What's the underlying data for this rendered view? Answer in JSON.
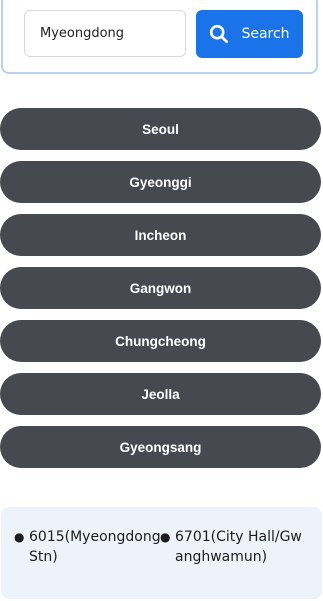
{
  "search": {
    "input_value": "Myeongdong",
    "button_label": "Search",
    "icon": "search-icon"
  },
  "regions": [
    {
      "label": "Seoul"
    },
    {
      "label": "Gyeonggi"
    },
    {
      "label": "Incheon"
    },
    {
      "label": "Gangwon"
    },
    {
      "label": "Chungcheong"
    },
    {
      "label": "Jeolla"
    },
    {
      "label": "Gyeongsang"
    }
  ],
  "stations": [
    {
      "label": "6015(Myeongdong Stn)"
    },
    {
      "label": "6701(City Hall/Gwanghwamun)"
    }
  ],
  "colors": {
    "accent": "#1a73e8",
    "region_button_bg": "#464a50",
    "station_panel_bg": "#eef3fb",
    "search_card_border": "#b9d2ef"
  }
}
